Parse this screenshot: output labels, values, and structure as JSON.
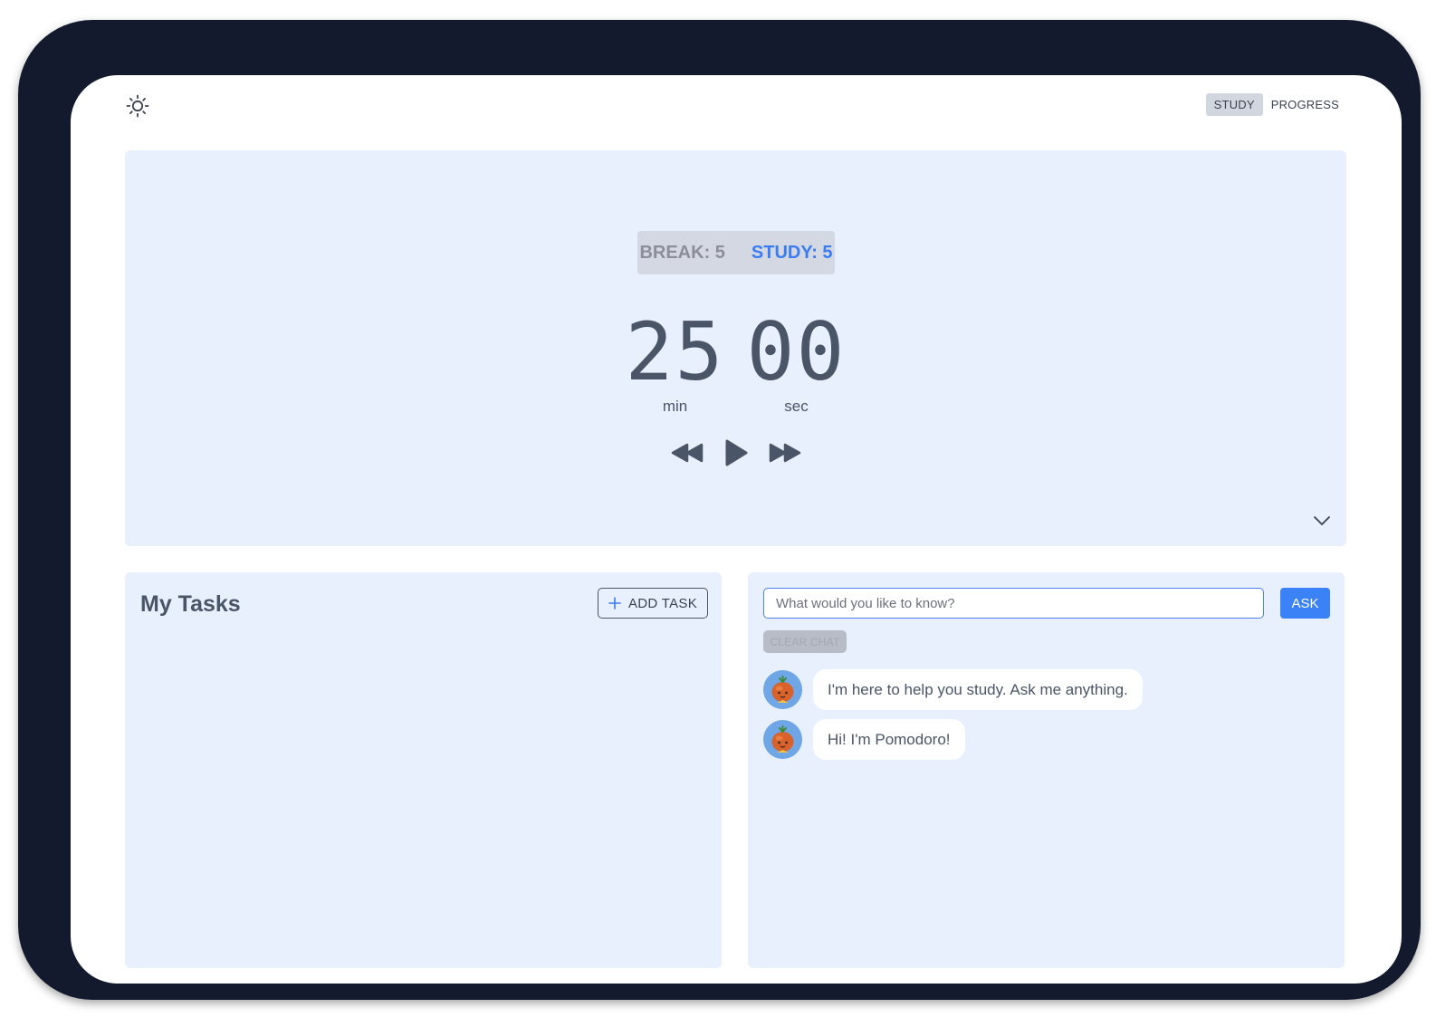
{
  "header": {
    "theme_icon": "sun-icon",
    "view_tabs": [
      {
        "label": "STUDY",
        "active": true
      },
      {
        "label": "PROGRESS",
        "active": false
      }
    ]
  },
  "timer": {
    "break_label": "BREAK: 5",
    "study_label": "STUDY: 5",
    "minutes": "25",
    "seconds": "00",
    "min_unit": "min",
    "sec_unit": "sec",
    "controls": [
      "rewind-icon",
      "play-icon",
      "fast-forward-icon"
    ],
    "study_color": "#3b7cf3"
  },
  "tasks": {
    "title": "My Tasks",
    "add_label": "ADD TASK"
  },
  "chat": {
    "placeholder": "What would you like to know?",
    "ask_label": "ASK",
    "clear_label": "CLEAR CHAT",
    "messages": [
      {
        "text": "I'm here to help you study. Ask me anything."
      },
      {
        "text": "Hi! I'm Pomodoro!"
      }
    ]
  },
  "colors": {
    "frame": "#141a2d",
    "card": "#e8effd",
    "accent": "#3b82f6"
  }
}
